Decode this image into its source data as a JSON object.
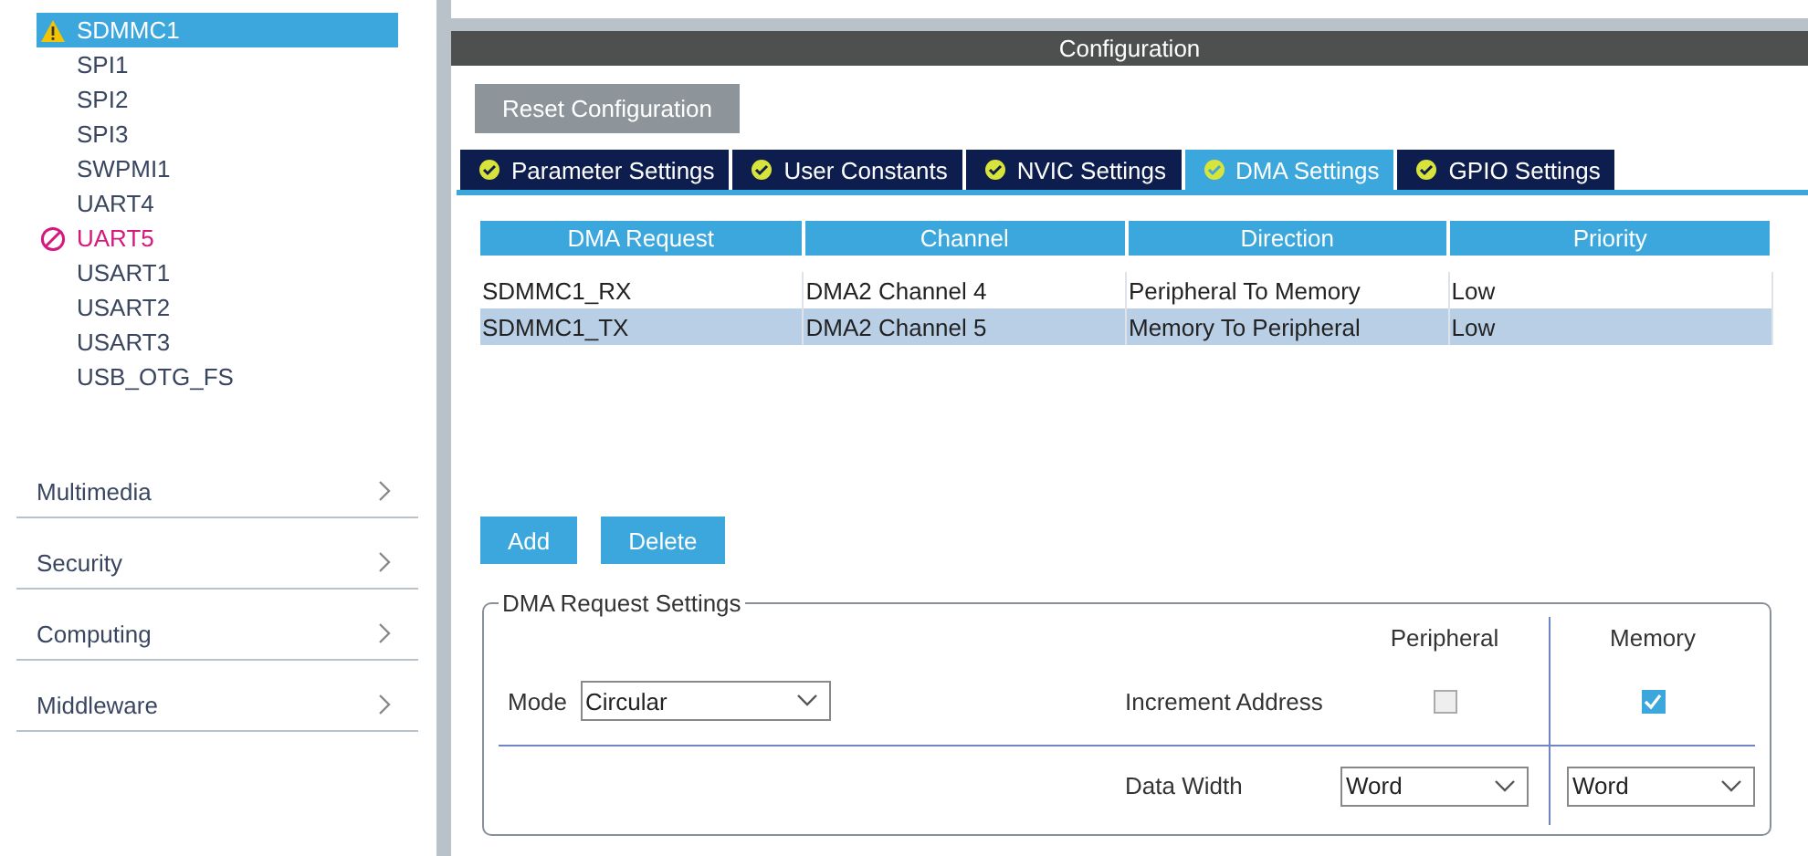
{
  "sidebar": {
    "peripherals": [
      {
        "label": "SDMMC1",
        "kind": "warning",
        "selected": true
      },
      {
        "label": "SPI1",
        "kind": "plain",
        "selected": false
      },
      {
        "label": "SPI2",
        "kind": "plain",
        "selected": false
      },
      {
        "label": "SPI3",
        "kind": "plain",
        "selected": false
      },
      {
        "label": "SWPMI1",
        "kind": "plain",
        "selected": false
      },
      {
        "label": "UART4",
        "kind": "plain",
        "selected": false
      },
      {
        "label": "UART5",
        "kind": "error",
        "selected": false
      },
      {
        "label": "USART1",
        "kind": "plain",
        "selected": false
      },
      {
        "label": "USART2",
        "kind": "plain",
        "selected": false
      },
      {
        "label": "USART3",
        "kind": "plain",
        "selected": false
      },
      {
        "label": "USB_OTG_FS",
        "kind": "plain",
        "selected": false
      }
    ],
    "categories": [
      {
        "label": "Multimedia"
      },
      {
        "label": "Security"
      },
      {
        "label": "Computing"
      },
      {
        "label": "Middleware"
      }
    ]
  },
  "configuration": {
    "title": "Configuration",
    "reset_button": "Reset Configuration",
    "tabs": [
      {
        "label": "Parameter Settings",
        "selected": false
      },
      {
        "label": "User Constants",
        "selected": false
      },
      {
        "label": "NVIC Settings",
        "selected": false
      },
      {
        "label": "DMA Settings",
        "selected": true
      },
      {
        "label": "GPIO Settings",
        "selected": false
      }
    ],
    "dma_table": {
      "columns": [
        "DMA Request",
        "Channel",
        "Direction",
        "Priority"
      ],
      "rows": [
        {
          "cells": [
            "SDMMC1_RX",
            "DMA2 Channel 4",
            "Peripheral To Memory",
            "Low"
          ],
          "selected": false
        },
        {
          "cells": [
            "SDMMC1_TX",
            "DMA2 Channel 5",
            "Memory To Peripheral",
            "Low"
          ],
          "selected": true
        }
      ]
    },
    "buttons": [
      "Add",
      "Delete"
    ],
    "request_settings": {
      "title": "DMA Request Settings",
      "mode_label": "Mode",
      "mode": "Circular",
      "column_headers": [
        "Peripheral",
        "Memory"
      ],
      "increment_label": "Increment Address",
      "increment": {
        "peripheral": false,
        "memory": true
      },
      "data_width_label": "Data Width",
      "data_width": {
        "peripheral": "Word",
        "memory": "Word"
      }
    }
  }
}
